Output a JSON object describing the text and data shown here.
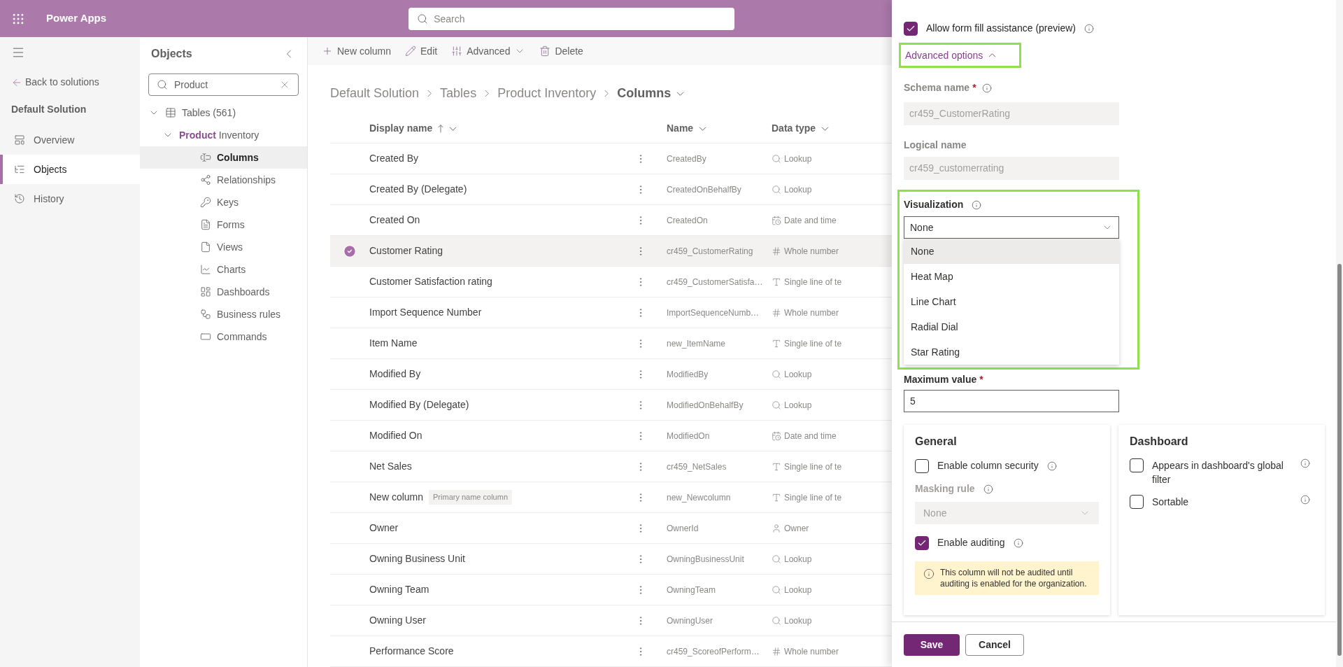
{
  "app": {
    "title": "Power Apps",
    "search_placeholder": "Search"
  },
  "nav": {
    "back": "Back to solutions",
    "solution": "Default Solution",
    "items": [
      {
        "label": "Overview",
        "kind": "overview",
        "selected": false
      },
      {
        "label": "Objects",
        "kind": "objects",
        "selected": true
      },
      {
        "label": "History",
        "kind": "history",
        "selected": false
      }
    ]
  },
  "objects_panel": {
    "title": "Objects",
    "search_value": "Product",
    "tree": [
      {
        "label": "Tables (561)",
        "kind": "tables",
        "expanded": true,
        "children": [
          {
            "label": "**Product** Inventory",
            "expanded": true,
            "children": [
              {
                "label": "Columns",
                "kind": "columns",
                "selected": true
              },
              {
                "label": "Relationships",
                "kind": "relationships",
                "selected": false
              },
              {
                "label": "Keys",
                "kind": "keys",
                "selected": false
              },
              {
                "label": "Forms",
                "kind": "forms",
                "selected": false
              },
              {
                "label": "Views",
                "kind": "views",
                "selected": false
              },
              {
                "label": "Charts",
                "kind": "charts",
                "selected": false
              },
              {
                "label": "Dashboards",
                "kind": "dashboards",
                "selected": false
              },
              {
                "label": "Business rules",
                "kind": "rules",
                "selected": false
              },
              {
                "label": "Commands",
                "kind": "commands",
                "selected": false
              }
            ]
          }
        ]
      }
    ]
  },
  "toolbar": [
    {
      "label": "New column",
      "kind": "add"
    },
    {
      "label": "Edit",
      "kind": "edit"
    },
    {
      "label": "Advanced",
      "kind": "advanced"
    },
    {
      "label": "Delete",
      "kind": "delete"
    }
  ],
  "breadcrumb": [
    "Default Solution",
    "Tables",
    "Product Inventory",
    "Columns"
  ],
  "table": {
    "columns": [
      "Display name",
      "Name",
      "Data type"
    ],
    "rows": [
      {
        "display": "Created By",
        "name": "CreatedBy",
        "type": "Lookup",
        "kind": "lookup",
        "selected": false
      },
      {
        "display": "Created By (Delegate)",
        "name": "CreatedOnBehalfBy",
        "type": "Lookup",
        "kind": "lookup",
        "selected": false
      },
      {
        "display": "Created On",
        "name": "CreatedOn",
        "type": "Date and time",
        "kind": "datetime",
        "selected": false
      },
      {
        "display": "Customer Rating",
        "name": "cr459_CustomerRating",
        "type": "Whole number",
        "kind": "number",
        "selected": true
      },
      {
        "display": "Customer Satisfaction rating",
        "name": "cr459_CustomerSatisfa…",
        "type": "Single line of te",
        "kind": "text",
        "selected": false
      },
      {
        "display": "Import Sequence Number",
        "name": "ImportSequenceNumb…",
        "type": "Whole number",
        "kind": "number",
        "selected": false
      },
      {
        "display": "Item Name",
        "name": "new_ItemName",
        "type": "Single line of te",
        "kind": "text",
        "selected": false
      },
      {
        "display": "Modified By",
        "name": "ModifiedBy",
        "type": "Lookup",
        "kind": "lookup",
        "selected": false
      },
      {
        "display": "Modified By (Delegate)",
        "name": "ModifiedOnBehalfBy",
        "type": "Lookup",
        "kind": "lookup",
        "selected": false
      },
      {
        "display": "Modified On",
        "name": "ModifiedOn",
        "type": "Date and time",
        "kind": "datetime",
        "selected": false
      },
      {
        "display": "Net Sales",
        "name": "cr459_NetSales",
        "type": "Single line of te",
        "kind": "text",
        "selected": false
      },
      {
        "display": "New column",
        "tag": "Primary name column",
        "name": "new_Newcolumn",
        "type": "Single line of te",
        "kind": "text",
        "selected": false
      },
      {
        "display": "Owner",
        "name": "OwnerId",
        "type": "Owner",
        "kind": "owner",
        "selected": false
      },
      {
        "display": "Owning Business Unit",
        "name": "OwningBusinessUnit",
        "type": "Lookup",
        "kind": "lookup",
        "selected": false
      },
      {
        "display": "Owning Team",
        "name": "OwningTeam",
        "type": "Lookup",
        "kind": "lookup",
        "selected": false
      },
      {
        "display": "Owning User",
        "name": "OwningUser",
        "type": "Lookup",
        "kind": "lookup",
        "selected": false
      },
      {
        "display": "Performance Score",
        "name": "cr459_ScoreofPerform…",
        "type": "Whole number",
        "kind": "number",
        "selected": false
      }
    ]
  },
  "panel": {
    "form_fill": {
      "label": "Allow form fill assistance (preview)",
      "checked": true
    },
    "advanced_options": {
      "label": "Advanced options",
      "expanded": true
    },
    "schema_name": {
      "label": "Schema name",
      "required_mark": "*",
      "value": "cr459_CustomerRating"
    },
    "logical_name": {
      "label": "Logical name",
      "value": "cr459_customerrating"
    },
    "visualization": {
      "label": "Visualization",
      "value": "None",
      "options": [
        {
          "label": "None",
          "selected": true
        },
        {
          "label": "Heat Map",
          "selected": false
        },
        {
          "label": "Line Chart",
          "selected": false
        },
        {
          "label": "Radial Dial",
          "selected": false
        },
        {
          "label": "Star Rating",
          "selected": false
        }
      ]
    },
    "maximum_value": {
      "label": "Maximum value",
      "required_mark": "*",
      "value": "5"
    },
    "general": {
      "title": "General",
      "column_security": {
        "label": "Enable column security",
        "checked": false
      },
      "masking_rule": {
        "label": "Masking rule",
        "value": "None",
        "disabled": true
      },
      "auditing": {
        "label": "Enable auditing",
        "checked": true
      },
      "warning": "This column will not be audited until auditing is enabled for the organization."
    },
    "dashboard": {
      "title": "Dashboard",
      "options": [
        {
          "label": "Appears in dashboard's global filter",
          "checked": false
        },
        {
          "label": "Sortable",
          "checked": false
        }
      ]
    },
    "buttons": {
      "save": "Save",
      "cancel": "Cancel"
    }
  }
}
